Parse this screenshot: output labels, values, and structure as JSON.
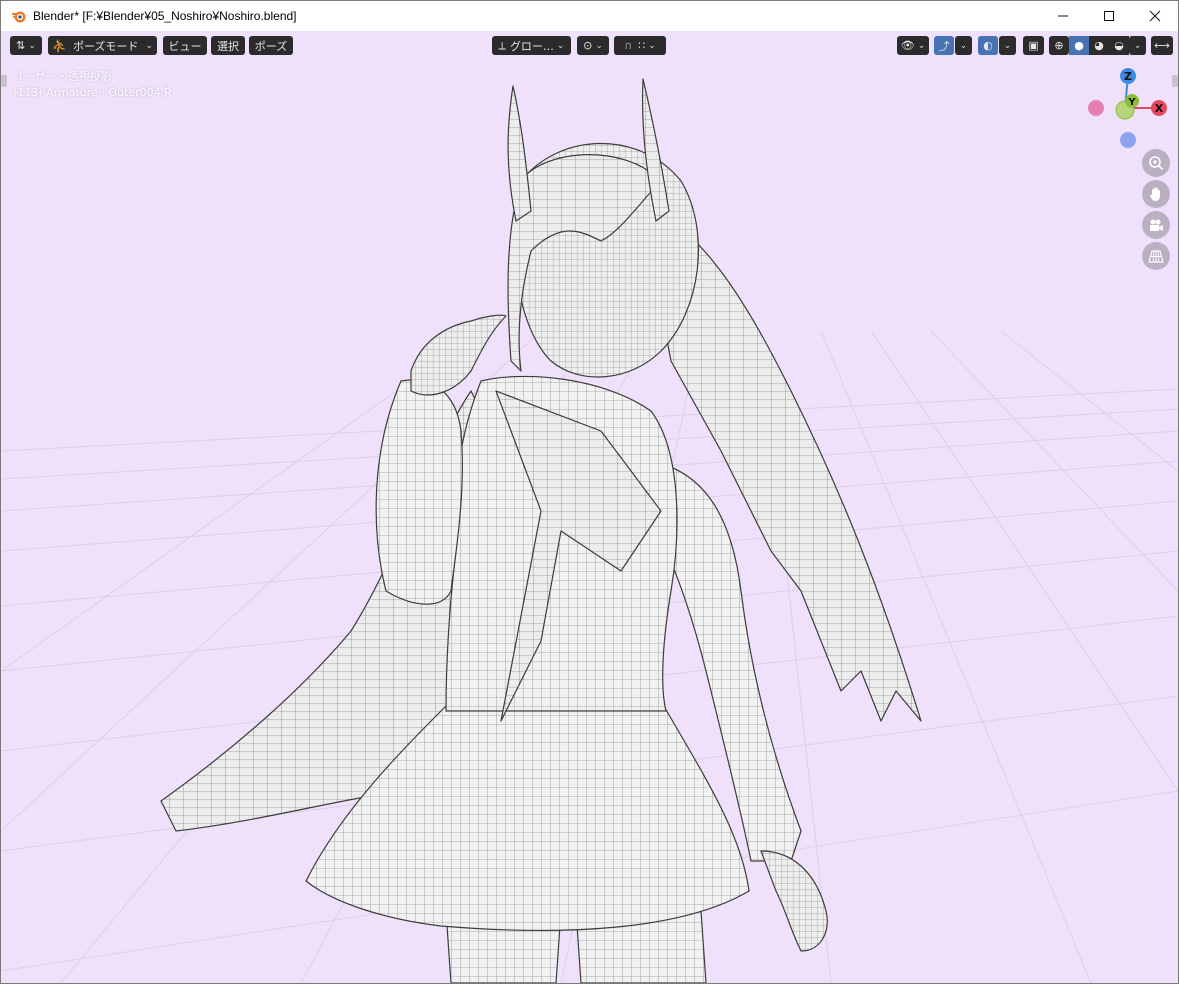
{
  "window": {
    "title": "Blender* [F:¥Blender¥05_Noshiro¥Noshiro.blend]",
    "controls": {
      "minimize": "—",
      "maximize": "☐",
      "close": "✕"
    }
  },
  "header": {
    "editor_icon": "⇅",
    "mode_label": "ポーズモード",
    "menus": [
      "ビュー",
      "選択",
      "ポーズ"
    ],
    "transform_orientation": "グロー…",
    "pivot_icon": "⊙",
    "snap_icon": "∩",
    "snap_target_icon": "∷"
  },
  "overlay": {
    "view_name": "ユーザー・透視投影",
    "active_object": "(113) Armature : Outer004.R"
  },
  "gizmo": {
    "axis_z": "Z",
    "axis_y": "Y",
    "axis_x": "X",
    "colors": {
      "x": "#e8465e",
      "y": "#8cbc38",
      "z": "#3b8ce4",
      "neg_x": "#e77fb0",
      "neg_z": "#8fa2ee"
    }
  },
  "nav_buttons": [
    "zoom-icon",
    "hand-icon",
    "camera-icon",
    "grid-icon"
  ],
  "colors": {
    "viewport_bg": "#efe0fb",
    "header_btn": "#2b2b2b",
    "active_blue": "#4772b3"
  }
}
